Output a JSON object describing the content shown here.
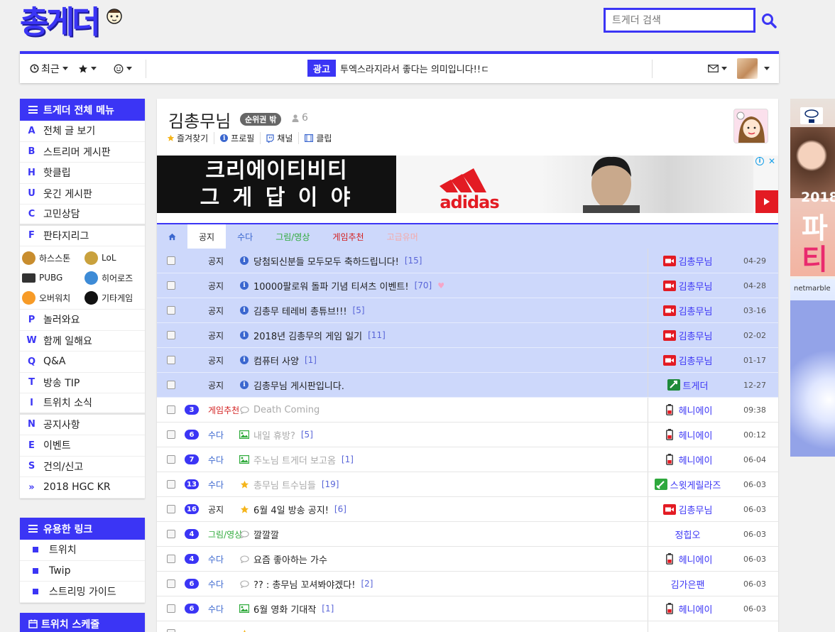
{
  "header": {
    "logo_text": "총게더",
    "search_placeholder": "트게더 검색"
  },
  "topnav": {
    "recent_label": "최근",
    "ad_badge": "광고",
    "ad_text": "투엑스라지라서 좋다는 의미입니다!!ㄷ"
  },
  "sidebar": {
    "menu_title": "트게더 전체 메뉴",
    "items": [
      {
        "key": "A",
        "label": "전체 글 보기"
      },
      {
        "key": "B",
        "label": "스트리머 게시판"
      },
      {
        "key": "H",
        "label": "핫클립"
      },
      {
        "key": "U",
        "label": "웃긴 게시판"
      },
      {
        "key": "C",
        "label": "고민상담"
      },
      {
        "key": "F",
        "label": "판타지리그"
      }
    ],
    "games": [
      {
        "label": "하스스톤",
        "icon": "hearthstone-icon"
      },
      {
        "label": "LoL",
        "icon": "lol-icon"
      },
      {
        "label": "PUBG",
        "icon": "pubg-icon"
      },
      {
        "label": "히어로즈",
        "icon": "heroes-icon"
      },
      {
        "label": "오버워치",
        "icon": "overwatch-icon"
      },
      {
        "label": "기타게임",
        "icon": "steam-icon"
      }
    ],
    "items2": [
      {
        "key": "P",
        "label": "놀러와요"
      },
      {
        "key": "W",
        "label": "함께 일해요"
      },
      {
        "key": "Q",
        "label": "Q&A"
      },
      {
        "key": "T",
        "label": "방송 TIP"
      },
      {
        "key": "I",
        "label": "트위치 소식"
      }
    ],
    "items3": [
      {
        "key": "N",
        "label": "공지사항"
      },
      {
        "key": "E",
        "label": "이벤트"
      },
      {
        "key": "S",
        "label": "건의/신고"
      },
      {
        "key": "»",
        "label": "2018 HGC KR"
      }
    ],
    "links_title": "유용한 링크",
    "links": [
      "트위치",
      "Twip",
      "스트리밍 가이드"
    ],
    "schedule_title": "트위치 스케줄"
  },
  "board": {
    "title": "김총무님",
    "rank_badge": "순위권 밖",
    "member_count": "6",
    "links": [
      "즐겨찾기",
      "프로필",
      "채널",
      "클립"
    ],
    "banner": {
      "line1": "크리에이티비티",
      "line2": "그 게  답 이 야",
      "brand": "adidas"
    },
    "tabs": [
      {
        "label": "공지",
        "color": "#222222"
      },
      {
        "label": "수다",
        "color": "#3b67cf"
      },
      {
        "label": "그림/영상",
        "color": "#2eaa3a"
      },
      {
        "label": "게임추천",
        "color": "#d32020"
      },
      {
        "label": "고급유머",
        "color": "#f4a9a9"
      }
    ],
    "rows": [
      {
        "notice": true,
        "num": "",
        "cat": "공지",
        "icon": "info",
        "title": "당첨되신분들 모두모두 축하드립니다!",
        "comments": "[15]",
        "role": "streamer",
        "author": "김총무님",
        "date": "04-29",
        "title_color": "#222222",
        "cat_color": "#222222"
      },
      {
        "notice": true,
        "num": "",
        "cat": "공지",
        "icon": "info",
        "title": "10000팔로워 돌파 기념 티셔츠 이벤트!",
        "comments": "[70]",
        "role": "streamer",
        "author": "김총무님",
        "date": "04-28",
        "title_color": "#222222",
        "cat_color": "#222222"
      },
      {
        "notice": true,
        "num": "",
        "cat": "공지",
        "icon": "info",
        "title": "김총무 테레비 총튜브!!!",
        "comments": "[5]",
        "role": "streamer",
        "author": "김총무님",
        "date": "03-16",
        "title_color": "#222222",
        "cat_color": "#222222"
      },
      {
        "notice": true,
        "num": "",
        "cat": "공지",
        "icon": "info",
        "title": "2018년 김총무의 게임 일기",
        "comments": "[11]",
        "role": "streamer",
        "author": "김총무님",
        "date": "02-02",
        "title_color": "#222222",
        "cat_color": "#222222"
      },
      {
        "notice": true,
        "num": "",
        "cat": "공지",
        "icon": "info",
        "title": "컴퓨터 사양",
        "comments": "[1]",
        "role": "streamer",
        "author": "김총무님",
        "date": "01-17",
        "title_color": "#222222",
        "cat_color": "#222222"
      },
      {
        "notice": true,
        "num": "",
        "cat": "공지",
        "icon": "info",
        "title": "김총무님 게시판입니다.",
        "comments": "",
        "role": "staff",
        "author": "트게더",
        "date": "12-27",
        "title_color": "#222222",
        "cat_color": "#222222"
      },
      {
        "notice": false,
        "num": "3",
        "cat": "게임추천",
        "icon": "chat",
        "title": "Death Coming",
        "comments": "",
        "role": "battery",
        "author": "헤니에이",
        "date": "09:38",
        "title_color": "#aaaaaa",
        "cat_color": "#d32020"
      },
      {
        "notice": false,
        "num": "6",
        "cat": "수다",
        "icon": "image",
        "title": "내일 휴방?",
        "comments": "[5]",
        "role": "battery",
        "author": "헤니에이",
        "date": "00:12",
        "title_color": "#aaaaaa",
        "cat_color": "#3b67cf"
      },
      {
        "notice": false,
        "num": "7",
        "cat": "수다",
        "icon": "image",
        "title": "주노님 트게더 보고옴",
        "comments": "[1]",
        "role": "battery",
        "author": "헤니에이",
        "date": "06-04",
        "title_color": "#aaaaaa",
        "cat_color": "#3b67cf"
      },
      {
        "notice": false,
        "num": "13",
        "cat": "수다",
        "icon": "star",
        "title": "총무님 트수님들",
        "comments": "[19]",
        "role": "sword",
        "author": "스윗게릴라즈",
        "date": "06-03",
        "title_color": "#aaaaaa",
        "cat_color": "#3b67cf"
      },
      {
        "notice": false,
        "num": "16",
        "cat": "공지",
        "icon": "star",
        "title": "6월 4일 방송 공지!",
        "comments": "[6]",
        "role": "streamer",
        "author": "김총무님",
        "date": "06-03",
        "title_color": "#222222",
        "cat_color": "#222222"
      },
      {
        "notice": false,
        "num": "4",
        "cat": "그림/영상",
        "icon": "chat",
        "title": "깔깔깔",
        "comments": "",
        "role": "none",
        "author": "정힙오",
        "date": "06-03",
        "title_color": "#222222",
        "cat_color": "#2eaa3a"
      },
      {
        "notice": false,
        "num": "4",
        "cat": "수다",
        "icon": "chat",
        "title": "요즘 좋아하는 가수",
        "comments": "",
        "role": "battery",
        "author": "헤니에이",
        "date": "06-03",
        "title_color": "#222222",
        "cat_color": "#3b67cf"
      },
      {
        "notice": false,
        "num": "6",
        "cat": "수다",
        "icon": "chat",
        "title": "?? : 총무님 꼬셔봐야겠다!",
        "comments": "[2]",
        "role": "none",
        "author": "김가은팬",
        "date": "06-03",
        "title_color": "#222222",
        "cat_color": "#3b67cf"
      },
      {
        "notice": false,
        "num": "6",
        "cat": "수다",
        "icon": "image",
        "title": "6월 영화 기대작",
        "comments": "[1]",
        "role": "battery",
        "author": "헤니에이",
        "date": "06-03",
        "title_color": "#222222",
        "cat_color": "#3b67cf"
      },
      {
        "notice": false,
        "num": "",
        "cat": "",
        "icon": "star",
        "title": "",
        "comments": "",
        "role": "none",
        "author": "",
        "date": "",
        "title_color": "#222222",
        "cat_color": "#2eaa3a"
      }
    ]
  },
  "ads_right": {
    "ad1_year": "2018",
    "ad1_text1": "파",
    "ad1_text2": "티",
    "ad2_brand": "netmarble"
  },
  "colors": {
    "accent": "#3b35f5",
    "notice_bg": "#cdd8fb"
  }
}
